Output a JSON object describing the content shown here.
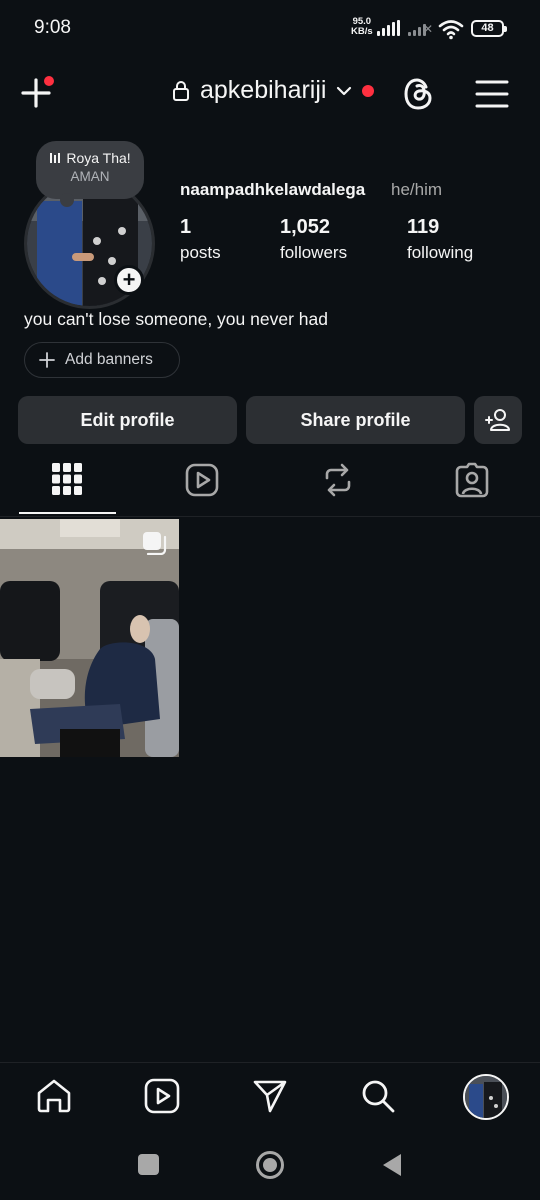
{
  "status_bar": {
    "time": "9:08",
    "network_speed_value": "95.0",
    "network_speed_unit": "KB/s",
    "battery": "48"
  },
  "header": {
    "username": "apkebihariji",
    "notification_dot": true
  },
  "note": {
    "title": "Roya Tha!",
    "subtitle": "AMAN"
  },
  "profile": {
    "name": "naampadhkelawdalega",
    "pronouns": "he/him",
    "stats": {
      "posts_count": "1",
      "posts_label": "posts",
      "followers_count": "1,052",
      "followers_label": "followers",
      "following_count": "119",
      "following_label": "following"
    },
    "bio": "you can't lose someone, you never had",
    "add_banners_label": "Add banners"
  },
  "actions": {
    "edit_label": "Edit profile",
    "share_label": "Share profile"
  },
  "tabs": [
    {
      "name": "grid",
      "active": true
    },
    {
      "name": "reels",
      "active": false
    },
    {
      "name": "reposts",
      "active": false
    },
    {
      "name": "tagged",
      "active": false
    }
  ],
  "posts": [
    {
      "type": "carousel"
    }
  ],
  "colors": {
    "background": "#0c1014",
    "button": "#2c2f33",
    "accent_red": "#ff3040"
  }
}
